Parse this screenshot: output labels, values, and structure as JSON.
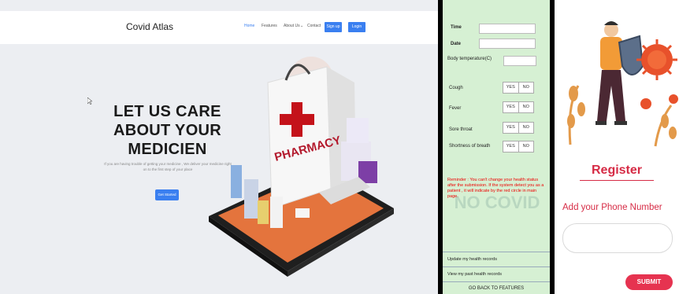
{
  "landing": {
    "brand": "Covid Atlas",
    "nav": {
      "home": "Home",
      "features": "Features",
      "about": "About Us",
      "contact": "Contact",
      "signup": "Sign up",
      "login": "Login"
    },
    "hero_lines": [
      "LET US CARE",
      "ABOUT YOUR",
      "MEDICIEN"
    ],
    "subtitle_lines": [
      "If you are having trouble of getting your medicine , We deliver your medicine right",
      "on to the first step of your place"
    ],
    "get_started": "Get Started",
    "bag_text": "PHARMACY"
  },
  "health_form": {
    "labels": {
      "time": "Time",
      "date": "Date",
      "temperature": "Body temperature(C)",
      "cough": "Cough",
      "fever": "Fever",
      "sore_throat": "Sore throat",
      "shortness": "Shortness of breath"
    },
    "yes": "YES",
    "no": "NO",
    "reminder": "Reminder : You can't change your health status after the submission. If the system detect you as a patient , it will indicate by the red circle in main page.",
    "watermark": "NO COVID",
    "links": {
      "update": "Update my health records",
      "past": "View my past health records",
      "back": "GO BACK TO FEATURES"
    }
  },
  "register": {
    "title": "Register",
    "phone_label": "Add your Phone Number",
    "phone_value": "",
    "submit": "SUBMIT"
  },
  "colors": {
    "accent_blue": "#3a7ff0",
    "form_green": "#d6f0d3",
    "register_red": "#d62b45",
    "reminder_red": "#ee0000"
  }
}
